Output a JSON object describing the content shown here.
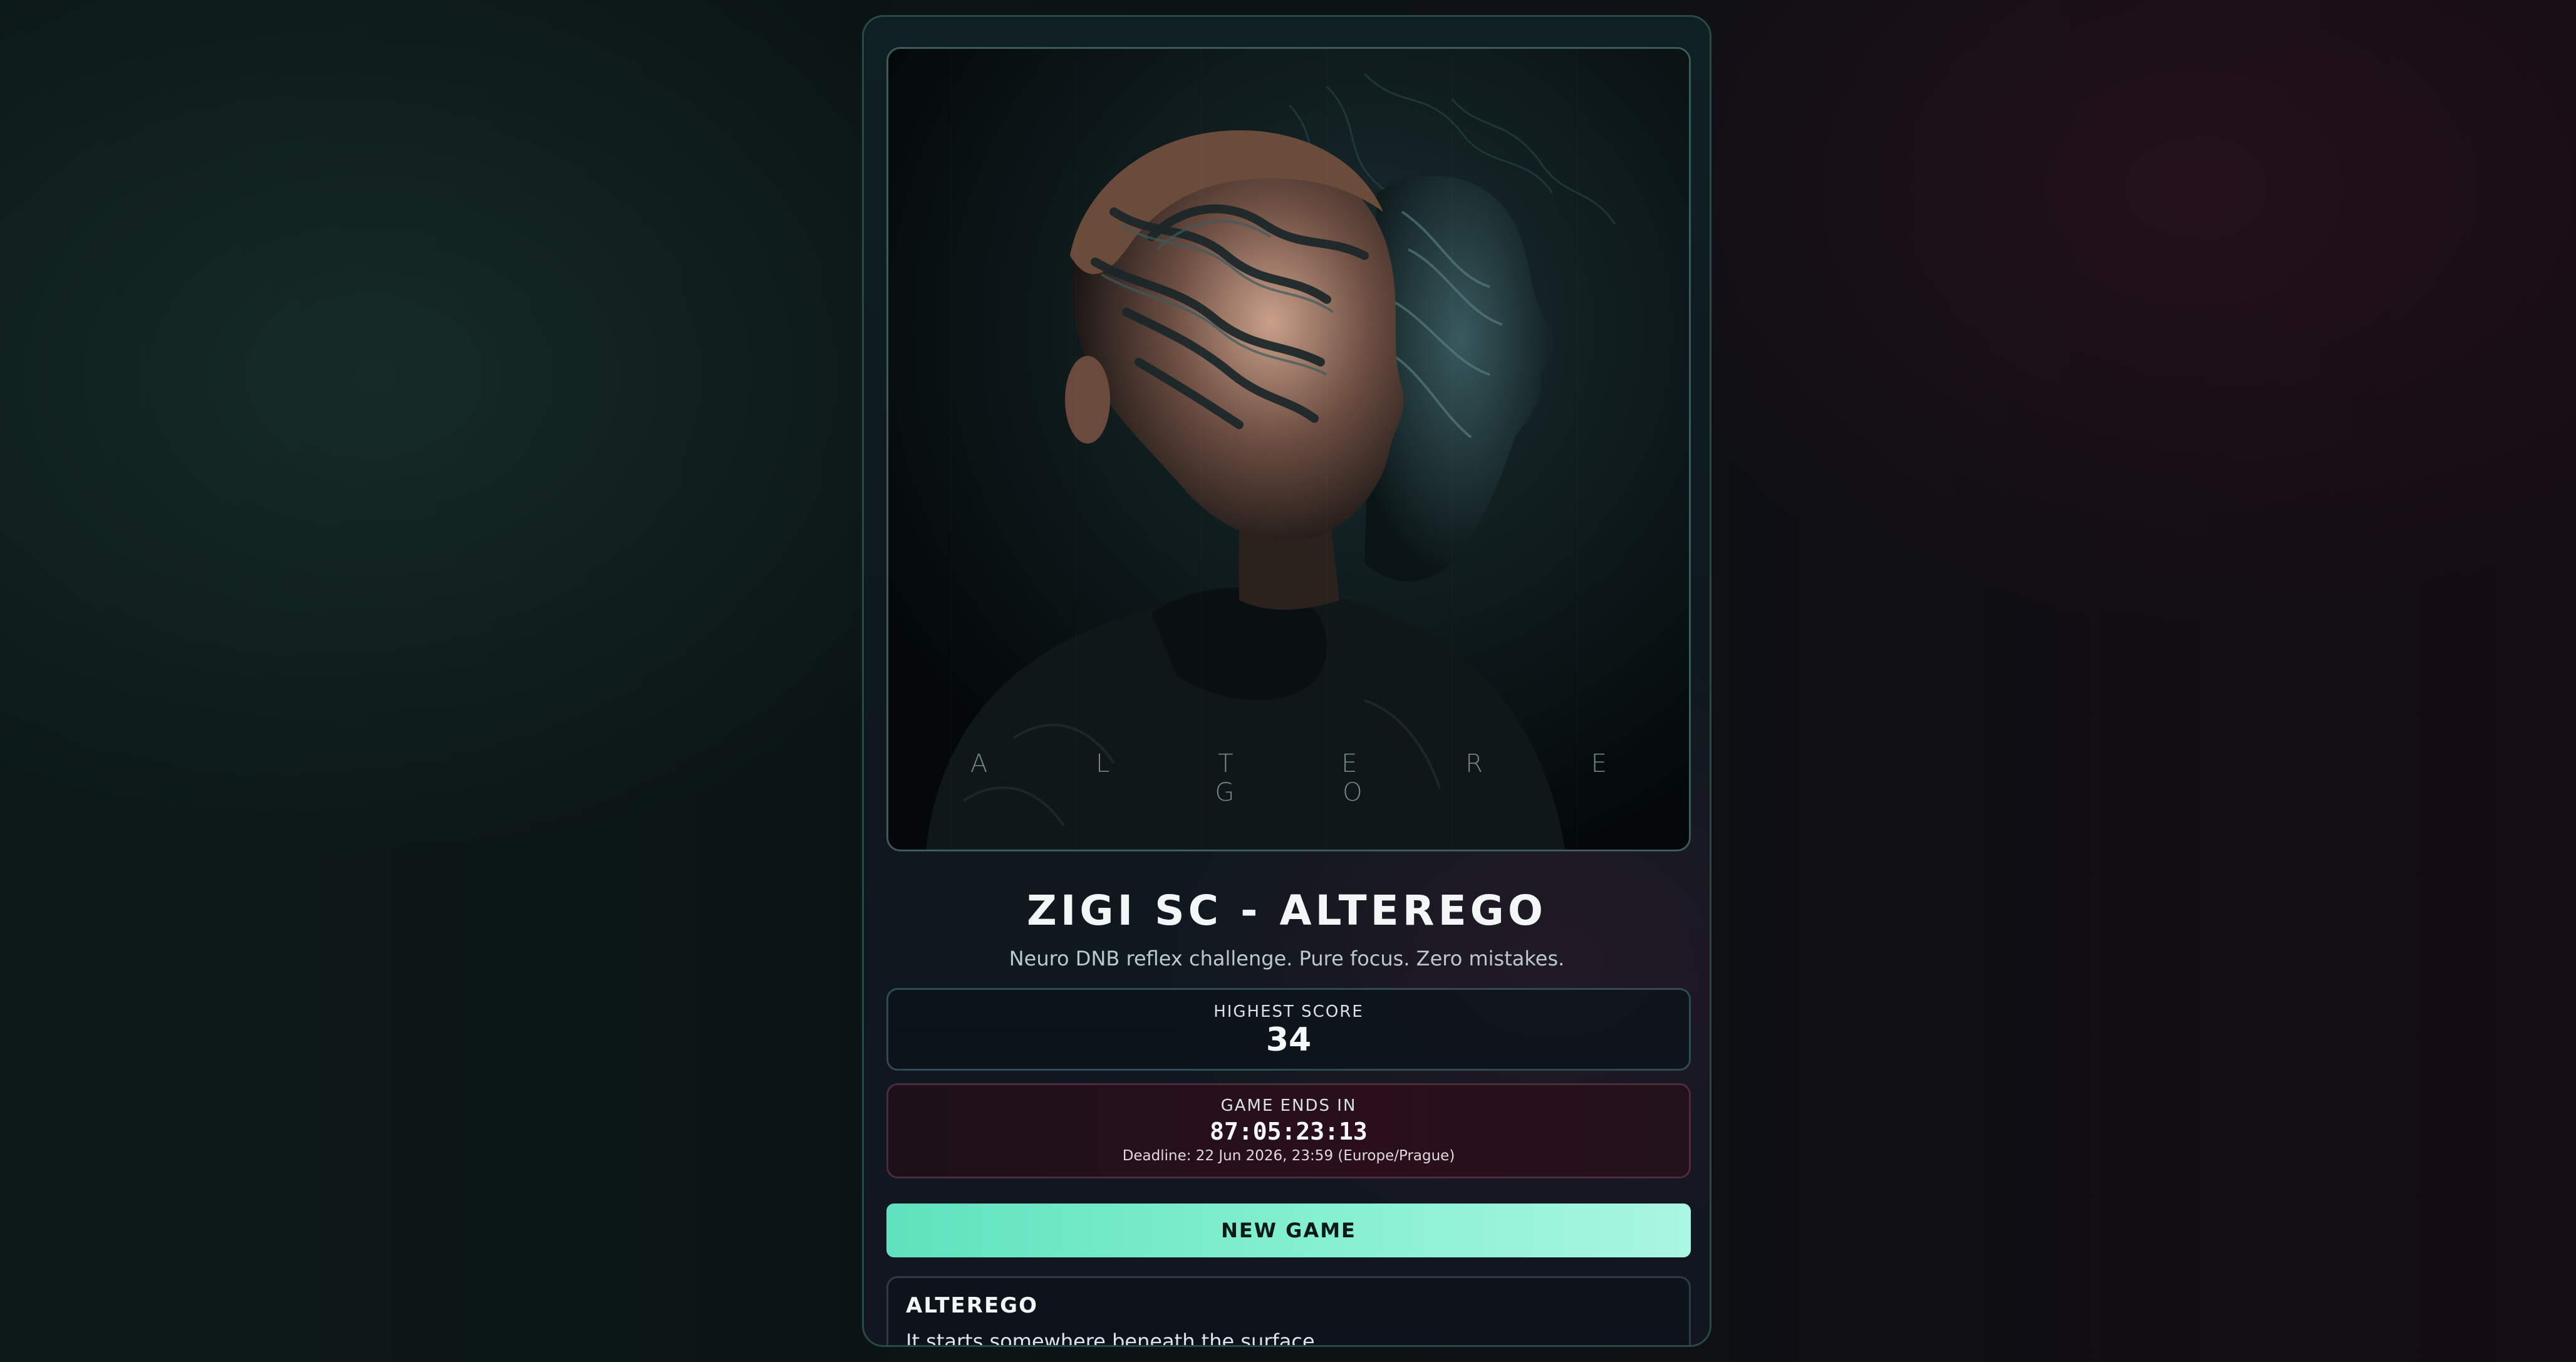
{
  "artwork": {
    "caption": "A L T E R E G O"
  },
  "game": {
    "title": "ZIGI SC - ALTEREGO",
    "tagline": "Neuro DNB reflex challenge. Pure focus. Zero mistakes."
  },
  "score": {
    "label": "HIGHEST SCORE",
    "value": "34"
  },
  "timer": {
    "label": "GAME ENDS IN",
    "countdown": "87:05:23:13",
    "deadline": "Deadline: 22 Jun 2026, 23:59 (Europe/Prague)"
  },
  "actions": {
    "new_game_label": "NEW GAME"
  },
  "info": {
    "title": "ALTEREGO",
    "text": "It starts somewhere beneath the surface."
  },
  "colors": {
    "accent": "#6ee8c6",
    "timer_bg": "#2a0f1a",
    "card_border": "#274a48"
  }
}
